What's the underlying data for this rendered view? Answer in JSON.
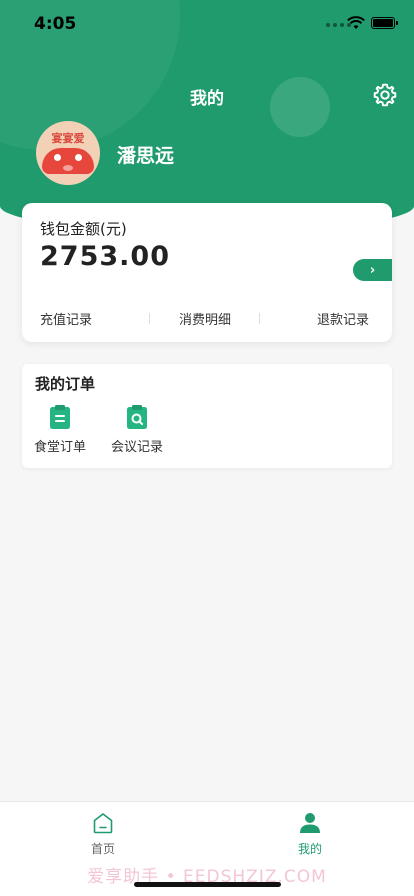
{
  "status_bar": {
    "time": "4:05"
  },
  "header": {
    "title": "我的",
    "settings_icon": "gear-icon",
    "bg_color": "#1f9b6d"
  },
  "profile": {
    "name": "潘思远",
    "avatar_text": "宴宴爱"
  },
  "wallet": {
    "label": "钱包金额(元)",
    "amount": "2753.00",
    "arrow": "›",
    "links": [
      "充值记录",
      "消费明细",
      "退款记录"
    ]
  },
  "orders": {
    "title": "我的订单",
    "items": [
      {
        "label": "食堂订单",
        "icon": "clipboard-list-icon"
      },
      {
        "label": "会议记录",
        "icon": "clipboard-search-icon"
      }
    ]
  },
  "tabbar": {
    "items": [
      {
        "label": "首页",
        "icon": "home-icon",
        "active": false
      },
      {
        "label": "我的",
        "icon": "user-icon",
        "active": true
      }
    ],
    "active_color": "#1f9b6d",
    "inactive_color": "#666666"
  },
  "watermark": "爱享助手 • EEDSHZIZ.COM"
}
